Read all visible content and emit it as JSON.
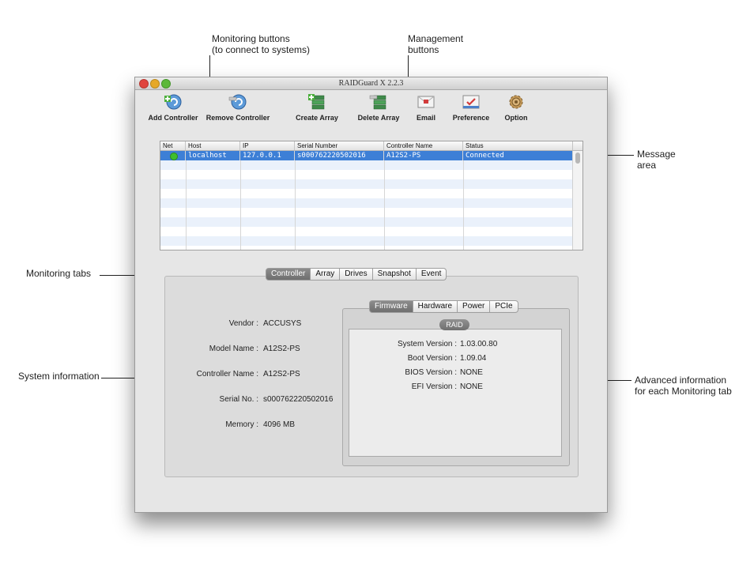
{
  "callouts": {
    "monitoring_buttons": [
      "Monitoring buttons",
      "(to connect to systems)"
    ],
    "management_buttons": [
      "Management",
      "buttons"
    ],
    "message_area": [
      "Message",
      "area"
    ],
    "monitoring_tabs": "Monitoring tabs",
    "system_information": "System information",
    "advanced_information": [
      "Advanced information",
      "for each Monitoring tab"
    ]
  },
  "window": {
    "title": "RAIDGuard X 2.2.3"
  },
  "toolbar": {
    "buttons": [
      {
        "label": "Add Controller",
        "icon": "add-controller-icon"
      },
      {
        "label": "Remove Controller",
        "icon": "remove-controller-icon"
      },
      {
        "label": "Create Array",
        "icon": "create-array-icon"
      },
      {
        "label": "Delete Array",
        "icon": "delete-array-icon"
      },
      {
        "label": "Email",
        "icon": "email-icon"
      },
      {
        "label": "Preference",
        "icon": "preference-icon"
      },
      {
        "label": "Option",
        "icon": "option-gear-icon"
      }
    ]
  },
  "table": {
    "columns": [
      "Net",
      "Host",
      "IP",
      "Serial Number",
      "Controller Name",
      "Status"
    ],
    "rows": [
      {
        "net": "online",
        "host": "localhost",
        "ip": "127.0.0.1",
        "serial": "s000762220502016",
        "controller_name": "A12S2-PS",
        "status": "Connected"
      }
    ]
  },
  "monitoring_tabs": [
    "Controller",
    "Array",
    "Drives",
    "Snapshot",
    "Event"
  ],
  "system_info": [
    {
      "label": "Vendor :",
      "value": "ACCUSYS"
    },
    {
      "label": "Model Name :",
      "value": "A12S2-PS"
    },
    {
      "label": "Controller Name :",
      "value": "A12S2-PS"
    },
    {
      "label": "Serial No. :",
      "value": "s000762220502016"
    },
    {
      "label": "Memory :",
      "value": "4096 MB"
    }
  ],
  "advanced_tabs": [
    "Firmware",
    "Hardware",
    "Power",
    "PCIe"
  ],
  "raid_badge": "RAID",
  "firmware_info": [
    {
      "label": "System Version :",
      "value": "1.03.00.80"
    },
    {
      "label": "Boot Version :",
      "value": "1.09.04"
    },
    {
      "label": "BIOS Version :",
      "value": "NONE"
    },
    {
      "label": "EFI Version :",
      "value": "NONE"
    }
  ],
  "colors": {
    "selection": "#3d7fd6",
    "row_stripe": "#eaf1fb",
    "status_online": "#3fbf2e",
    "tab_active": "#7b7b7b"
  }
}
